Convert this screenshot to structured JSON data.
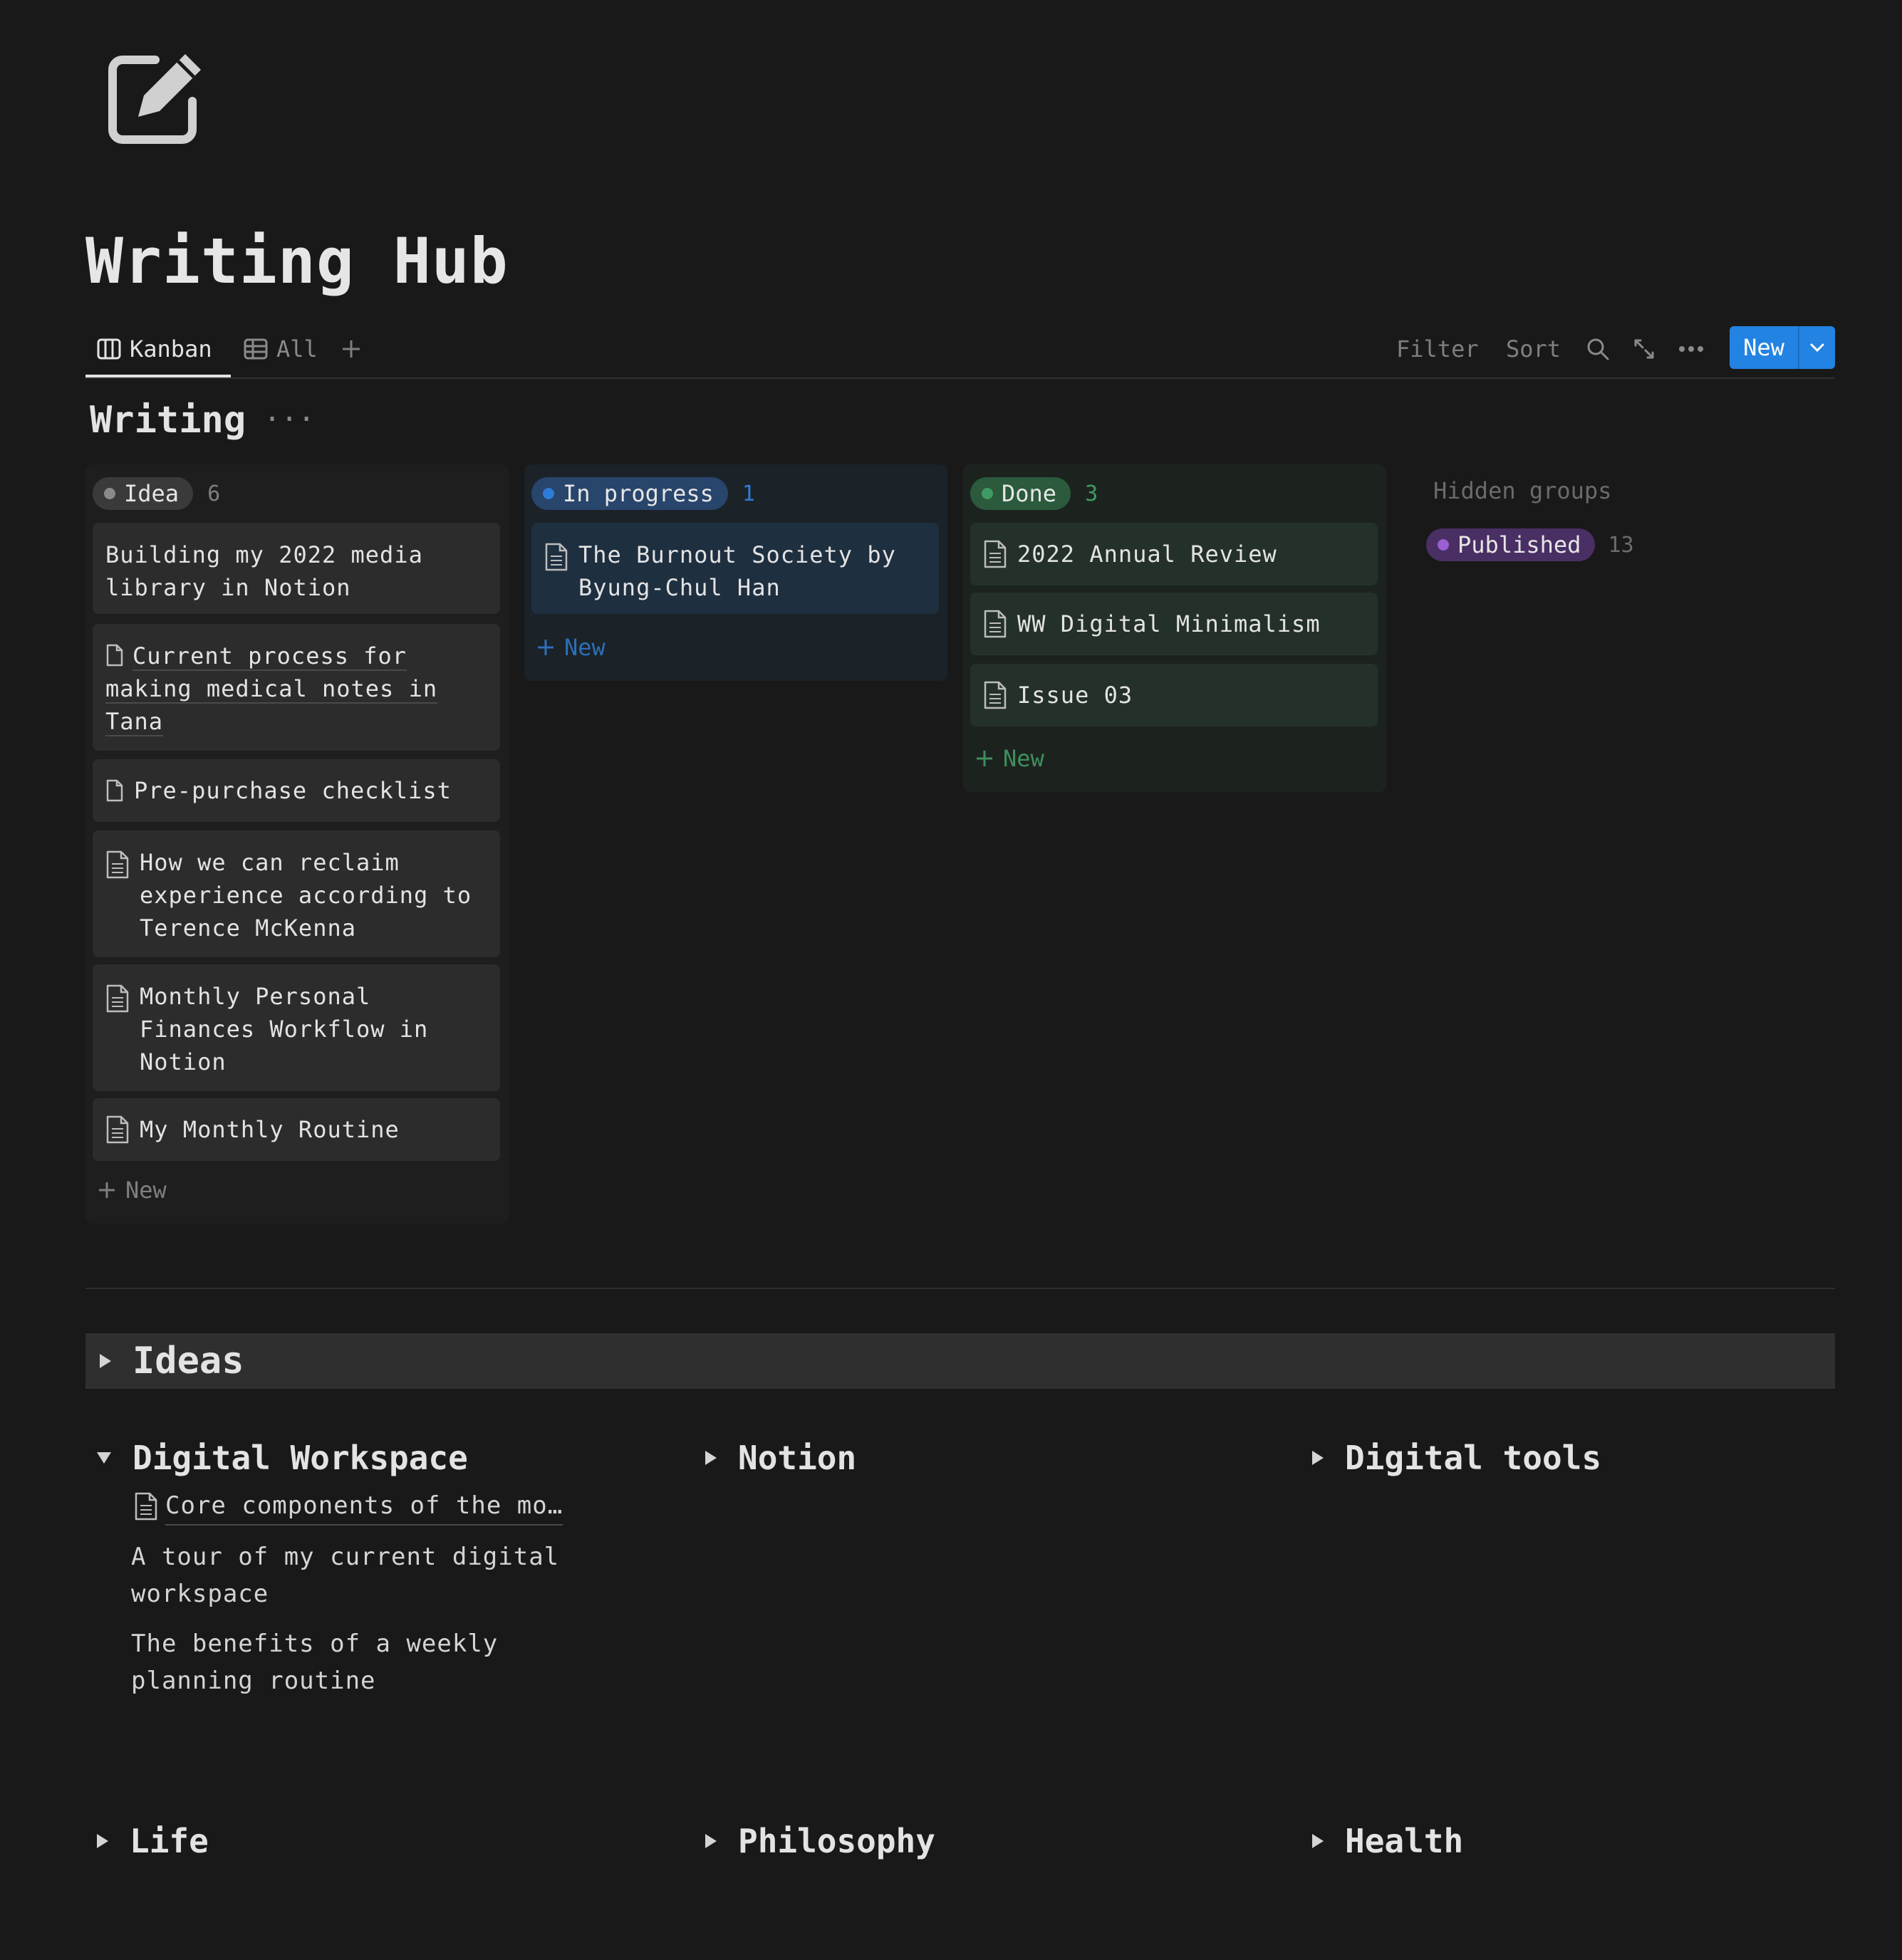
{
  "page": {
    "icon": "edit-square-icon",
    "title": "Writing Hub"
  },
  "views": {
    "tabs": [
      {
        "label": "Kanban",
        "icon": "board-icon",
        "active": true
      },
      {
        "label": "All",
        "icon": "table-icon",
        "active": false
      }
    ],
    "add_view_icon": "plus-icon",
    "toolbar": {
      "filter": "Filter",
      "sort": "Sort",
      "search_icon": "search-icon",
      "expand_icon": "expand-icon",
      "more_icon": "more-icon",
      "new_label": "New",
      "new_dropdown_icon": "chevron-down-icon",
      "accent": "#2383e2"
    }
  },
  "board": {
    "title": "Writing",
    "more": "···",
    "columns": [
      {
        "status": "Idea",
        "count": "6",
        "color": "#8a8a8a",
        "cards": [
          {
            "title": "Building my 2022 media library in Notion"
          },
          {
            "title": "Current process for making medical notes in Tana"
          },
          {
            "title": "Pre-purchase checklist"
          },
          {
            "title": "How we can reclaim experience according to Terence McKenna"
          },
          {
            "title": "Monthly Personal Finances Workflow in Notion"
          },
          {
            "title": "My Monthly Routine"
          }
        ],
        "new_label": "New"
      },
      {
        "status": "In progress",
        "count": "1",
        "color": "#2e7cd6",
        "cards": [
          {
            "title": "The Burnout Society by Byung-Chul Han"
          }
        ],
        "new_label": "New"
      },
      {
        "status": "Done",
        "count": "3",
        "color": "#3f9b63",
        "cards": [
          {
            "title": "2022 Annual Review"
          },
          {
            "title": "WW Digital Minimalism"
          },
          {
            "title": "Issue 03"
          }
        ],
        "new_label": "New"
      }
    ],
    "hidden_groups": {
      "label": "Hidden groups",
      "items": [
        {
          "status": "Published",
          "count": "13",
          "color": "#9a5fd0"
        }
      ]
    }
  },
  "ideas": {
    "title": "Ideas",
    "groups": [
      {
        "title": "Digital Workspace",
        "expanded": true,
        "items": [
          {
            "text": "Core components of the mo…",
            "linked": true
          },
          {
            "text": "A tour of my current digital workspace",
            "linked": false
          },
          {
            "text": "The benefits of a weekly planning routine",
            "linked": false
          }
        ]
      },
      {
        "title": "Notion",
        "expanded": false,
        "items": []
      },
      {
        "title": "Digital tools",
        "expanded": false,
        "items": []
      },
      {
        "title": "Life",
        "expanded": false,
        "items": []
      },
      {
        "title": "Philosophy",
        "expanded": false,
        "items": []
      },
      {
        "title": "Health",
        "expanded": false,
        "items": []
      }
    ]
  }
}
